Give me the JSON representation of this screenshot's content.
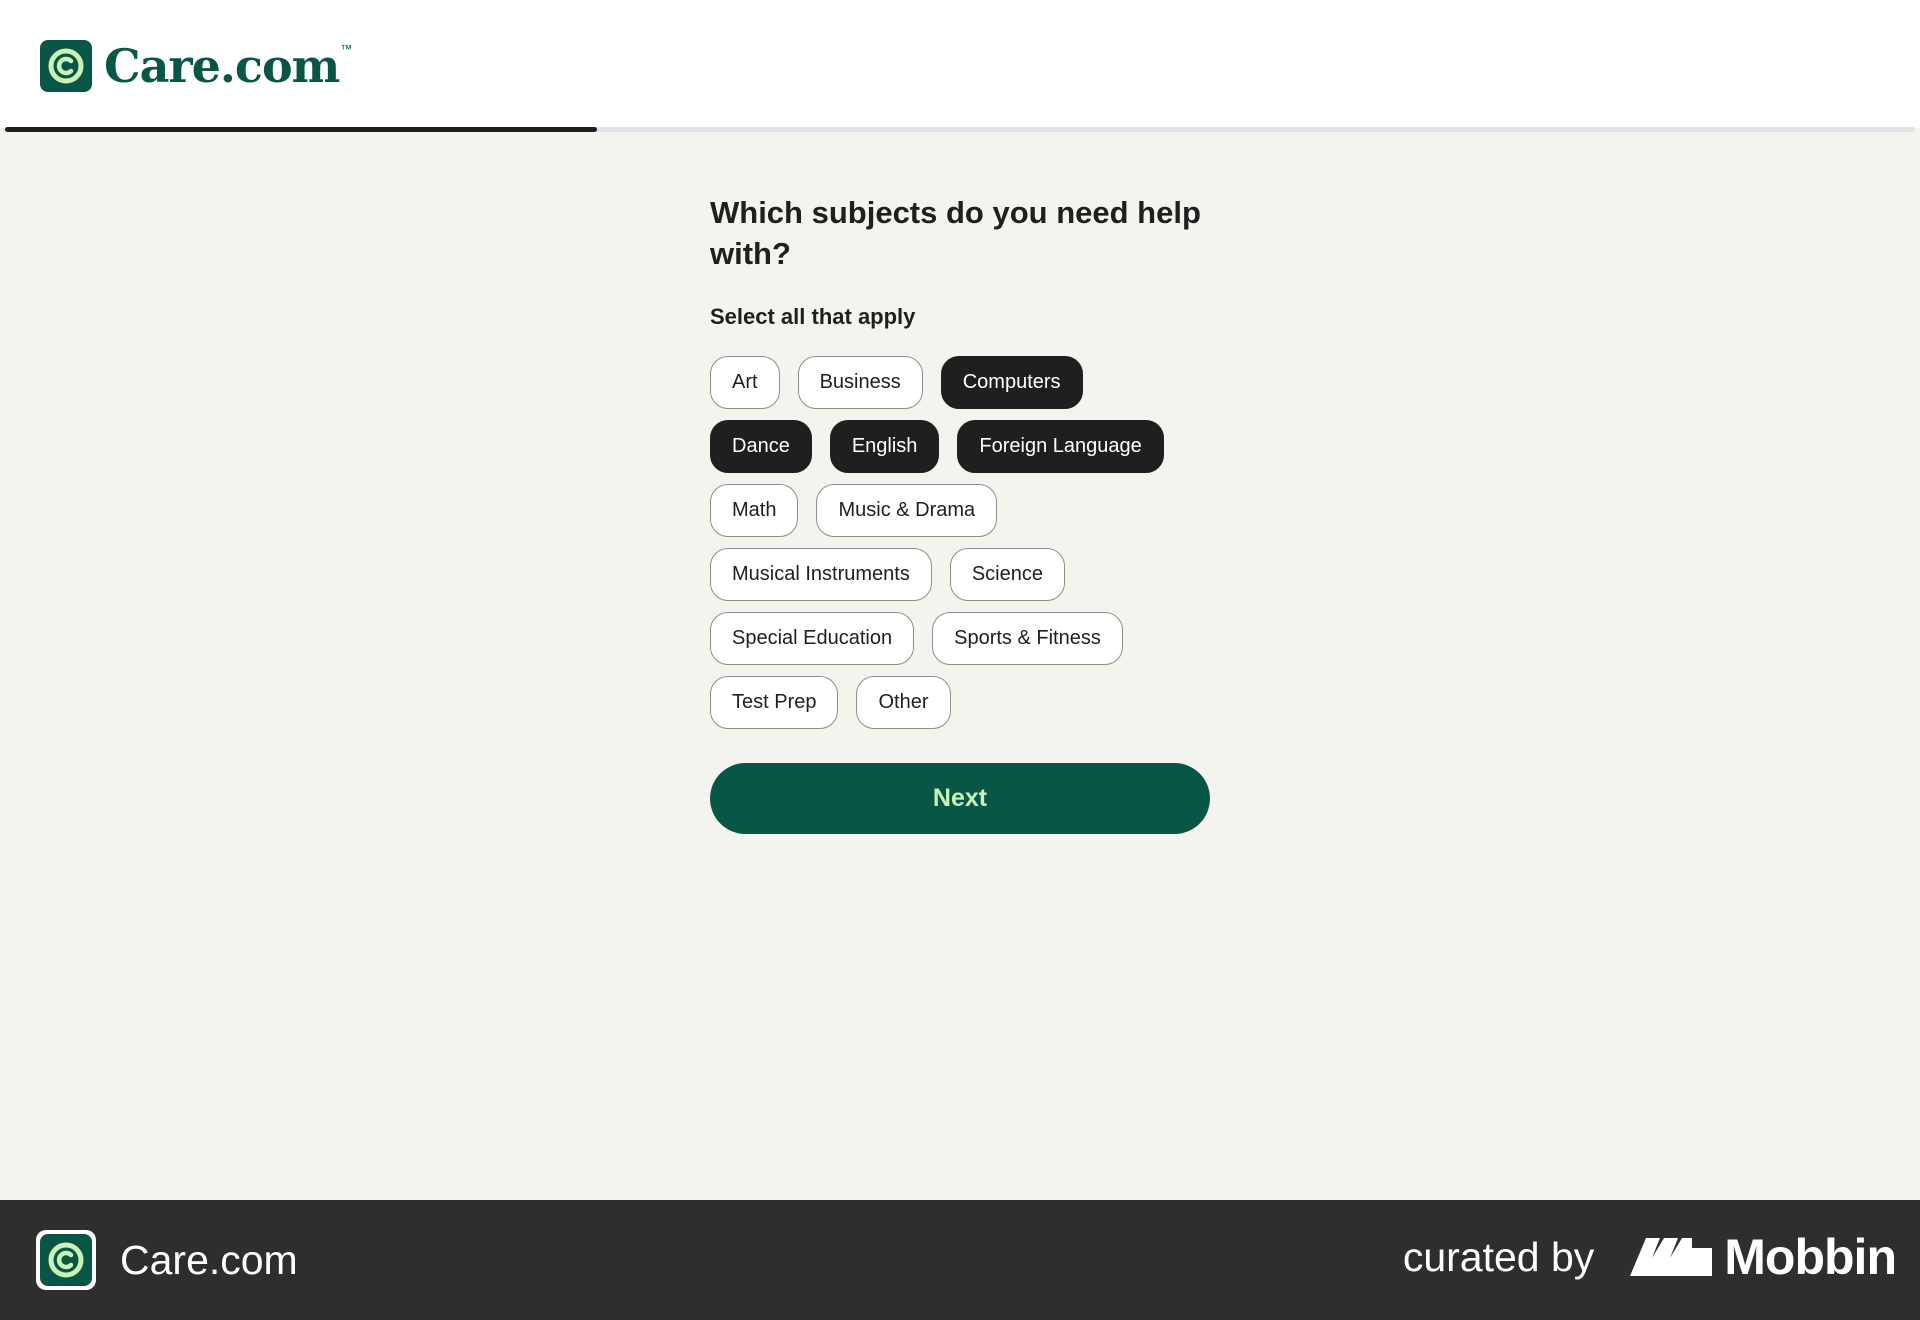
{
  "header": {
    "logo_text": "Care.com",
    "logo_tm": "™",
    "progress": 0.31
  },
  "question": {
    "title": "Which subjects do you need help with?",
    "subtitle": "Select all that apply"
  },
  "subjects": [
    {
      "label": "Art",
      "selected": false
    },
    {
      "label": "Business",
      "selected": false
    },
    {
      "label": "Computers",
      "selected": true
    },
    {
      "label": "Dance",
      "selected": true
    },
    {
      "label": "English",
      "selected": true
    },
    {
      "label": "Foreign Language",
      "selected": true
    },
    {
      "label": "Math",
      "selected": false
    },
    {
      "label": "Music & Drama",
      "selected": false
    },
    {
      "label": "Musical Instruments",
      "selected": false
    },
    {
      "label": "Science",
      "selected": false
    },
    {
      "label": "Special Education",
      "selected": false
    },
    {
      "label": "Sports & Fitness",
      "selected": false
    },
    {
      "label": "Test Prep",
      "selected": false
    },
    {
      "label": "Other",
      "selected": false
    }
  ],
  "next_label": "Next",
  "footer": {
    "app_name": "Care.com",
    "curated_by": "curated by",
    "brand": "Mobbin"
  },
  "colors": {
    "brand_green": "#0a5646",
    "button_text": "#c9f2b5",
    "selected_chip": "#1f1f1f",
    "page_background": "#f5f3ee"
  }
}
